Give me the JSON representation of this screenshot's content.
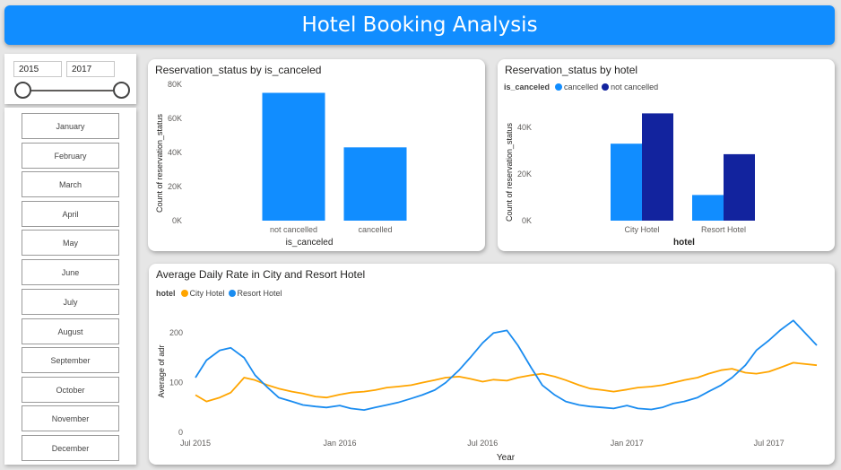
{
  "header": {
    "title": "Hotel Booking Analysis"
  },
  "year_slicer": {
    "start": "2015",
    "end": "2017"
  },
  "months": [
    "January",
    "February",
    "March",
    "April",
    "May",
    "June",
    "July",
    "August",
    "September",
    "October",
    "November",
    "December"
  ],
  "colors": {
    "blue": "#118dff",
    "navy": "#12239e",
    "orange": "#ffa500",
    "resort": "#1a8cf0"
  },
  "chart_data": [
    {
      "type": "bar",
      "title": "Reservation_status by is_canceled",
      "xlabel": "is_canceled",
      "ylabel": "Count of reservation_status",
      "categories": [
        "not cancelled",
        "cancelled"
      ],
      "values": [
        75000,
        43000
      ],
      "ylim": [
        0,
        80000
      ],
      "yticks": [
        "0K",
        "20K",
        "40K",
        "60K",
        "80K"
      ],
      "grid": false
    },
    {
      "type": "bar",
      "title": "Reservation_status by hotel",
      "xlabel": "hotel",
      "ylabel": "Count of reservation_status",
      "legend_title": "is_canceled",
      "categories": [
        "City Hotel",
        "Resort Hotel"
      ],
      "series": [
        {
          "name": "cancelled",
          "values": [
            33000,
            11000
          ]
        },
        {
          "name": "not cancelled",
          "values": [
            46000,
            28500
          ]
        }
      ],
      "ylim": [
        0,
        50000
      ],
      "yticks": [
        "0K",
        "20K",
        "40K"
      ],
      "legend": "top-left"
    },
    {
      "type": "line",
      "title": "Average Daily Rate in City and Resort Hotel",
      "xlabel": "Year",
      "ylabel": "Average of adr",
      "legend_title": "hotel",
      "x_ticks": [
        "Jul 2015",
        "Jan 2016",
        "Jul 2016",
        "Jan 2017",
        "Jul 2017"
      ],
      "x_range": [
        "2015-07-01",
        "2017-08-31"
      ],
      "ylim": [
        0,
        240
      ],
      "yticks": [
        "0",
        "100",
        "200"
      ],
      "series": [
        {
          "name": "City Hotel",
          "dates": [
            "2015-07-01",
            "2015-07-15",
            "2015-08-01",
            "2015-08-15",
            "2015-09-01",
            "2015-09-15",
            "2015-10-01",
            "2015-10-15",
            "2015-11-01",
            "2015-11-15",
            "2015-12-01",
            "2015-12-15",
            "2016-01-01",
            "2016-01-15",
            "2016-02-01",
            "2016-02-15",
            "2016-03-01",
            "2016-03-15",
            "2016-04-01",
            "2016-04-15",
            "2016-05-01",
            "2016-05-15",
            "2016-06-01",
            "2016-06-15",
            "2016-07-01",
            "2016-07-15",
            "2016-08-01",
            "2016-08-15",
            "2016-09-01",
            "2016-09-15",
            "2016-10-01",
            "2016-10-15",
            "2016-11-01",
            "2016-11-15",
            "2016-12-01",
            "2016-12-15",
            "2017-01-01",
            "2017-01-15",
            "2017-02-01",
            "2017-02-15",
            "2017-03-01",
            "2017-03-15",
            "2017-04-01",
            "2017-04-15",
            "2017-05-01",
            "2017-05-15",
            "2017-06-01",
            "2017-06-15",
            "2017-07-01",
            "2017-07-15",
            "2017-08-01",
            "2017-08-31"
          ],
          "values": [
            75,
            62,
            70,
            80,
            110,
            105,
            95,
            88,
            82,
            78,
            72,
            70,
            76,
            80,
            82,
            85,
            90,
            92,
            95,
            100,
            105,
            110,
            112,
            108,
            102,
            106,
            104,
            110,
            115,
            118,
            112,
            105,
            95,
            88,
            85,
            82,
            86,
            90,
            92,
            95,
            100,
            105,
            110,
            118,
            125,
            128,
            120,
            118,
            122,
            130,
            140,
            135
          ]
        },
        {
          "name": "Resort Hotel",
          "dates": [
            "2015-07-01",
            "2015-07-15",
            "2015-08-01",
            "2015-08-15",
            "2015-09-01",
            "2015-09-15",
            "2015-10-01",
            "2015-10-15",
            "2015-11-01",
            "2015-11-15",
            "2015-12-01",
            "2015-12-15",
            "2016-01-01",
            "2016-01-15",
            "2016-02-01",
            "2016-02-15",
            "2016-03-01",
            "2016-03-15",
            "2016-04-01",
            "2016-04-15",
            "2016-05-01",
            "2016-05-15",
            "2016-06-01",
            "2016-06-15",
            "2016-07-01",
            "2016-07-15",
            "2016-08-01",
            "2016-08-15",
            "2016-09-01",
            "2016-09-15",
            "2016-10-01",
            "2016-10-15",
            "2016-11-01",
            "2016-11-15",
            "2016-12-01",
            "2016-12-15",
            "2017-01-01",
            "2017-01-15",
            "2017-02-01",
            "2017-02-15",
            "2017-03-01",
            "2017-03-15",
            "2017-04-01",
            "2017-04-15",
            "2017-05-01",
            "2017-05-15",
            "2017-06-01",
            "2017-06-15",
            "2017-07-01",
            "2017-07-15",
            "2017-08-01",
            "2017-08-31"
          ],
          "values": [
            110,
            145,
            165,
            170,
            150,
            115,
            90,
            70,
            62,
            55,
            52,
            50,
            54,
            48,
            45,
            50,
            55,
            60,
            68,
            75,
            85,
            100,
            125,
            150,
            180,
            200,
            205,
            175,
            130,
            95,
            75,
            62,
            55,
            52,
            50,
            48,
            54,
            48,
            46,
            50,
            58,
            62,
            70,
            82,
            95,
            110,
            135,
            165,
            185,
            205,
            225,
            175
          ]
        }
      ]
    }
  ]
}
